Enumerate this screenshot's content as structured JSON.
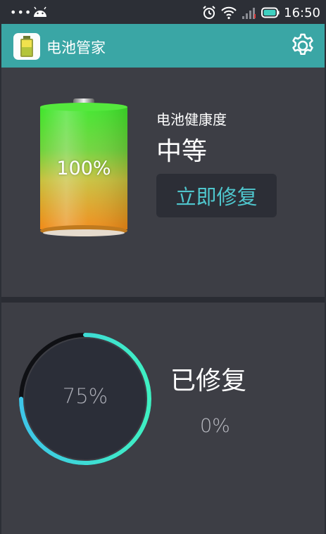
{
  "status_bar": {
    "time": "16:50",
    "dots": "•••",
    "icons": [
      "notification-dots-icon",
      "android-icon",
      "alarm-icon",
      "wifi-icon",
      "signal-icon",
      "battery-icon"
    ]
  },
  "app": {
    "title": "电池管家",
    "accent_color": "#3aa6a5",
    "icons": [
      "battery-app-logo-icon",
      "settings-gear-icon"
    ]
  },
  "battery_card": {
    "charge_percent": "100%",
    "health_label": "电池健康度",
    "health_value": "中等",
    "repair_button_label": "立即修复",
    "button_text_color": "#4fc6cd"
  },
  "repair_card": {
    "progress_percent": "75%",
    "progress_fraction": 0.75,
    "status_title": "已修复",
    "repaired_percent": "0%",
    "ring_colors": [
      "#3ec6e8",
      "#3ff0c2"
    ]
  }
}
